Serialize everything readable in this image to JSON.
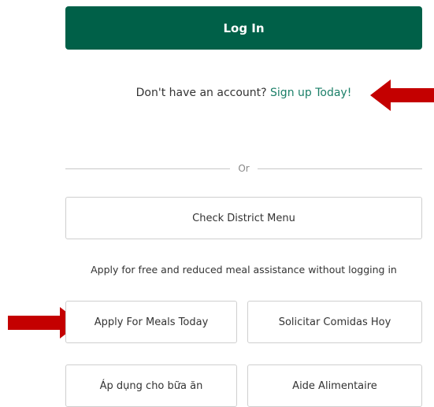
{
  "login": {
    "button_label": "Log In"
  },
  "signup": {
    "prompt": "Don't have an account?",
    "link_label": "Sign up Today!"
  },
  "divider": {
    "label": "Or"
  },
  "district_menu": {
    "button_label": "Check District Menu"
  },
  "apply": {
    "note": "Apply for free and reduced meal assistance without logging in",
    "buttons": [
      {
        "label": "Apply For Meals Today"
      },
      {
        "label": "Solicitar Comidas Hoy"
      },
      {
        "label": "Áp dụng cho bữa ăn"
      },
      {
        "label": "Aide Alimentaire"
      }
    ]
  },
  "colors": {
    "primary": "#006048",
    "link": "#1b7f68",
    "arrow": "#c40000",
    "border": "#cfcfcf"
  },
  "icons": {
    "annotation_arrows": [
      "arrow-left-icon",
      "arrow-right-icon"
    ]
  }
}
